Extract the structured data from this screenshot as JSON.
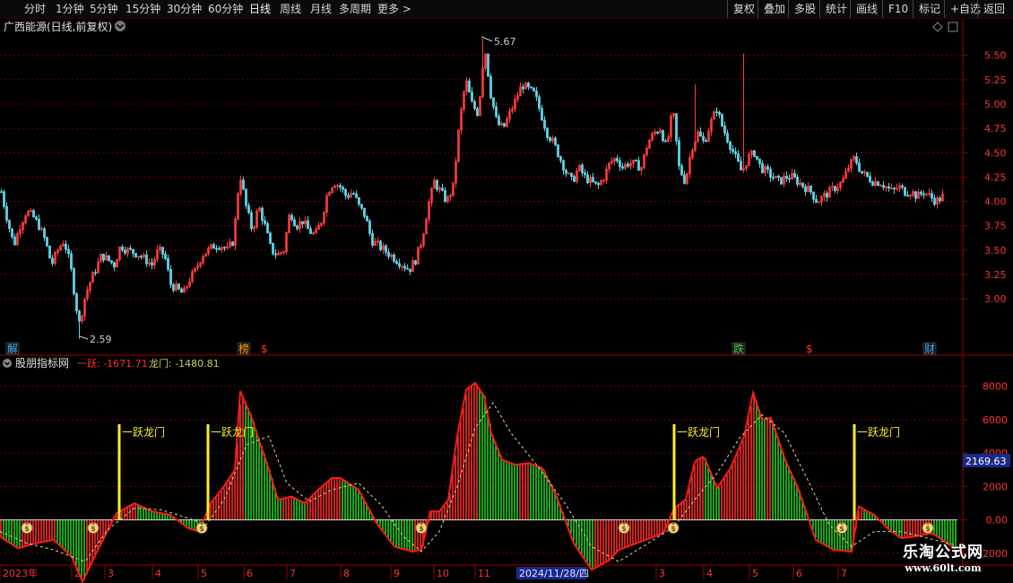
{
  "toolbar": {
    "left": [
      {
        "label": "分时",
        "name": "period-intraday"
      },
      {
        "label": "1分钟",
        "name": "period-1min"
      },
      {
        "label": "5分钟",
        "name": "period-5min"
      },
      {
        "label": "15分钟",
        "name": "period-15min"
      },
      {
        "label": "30分钟",
        "name": "period-30min"
      },
      {
        "label": "60分钟",
        "name": "period-60min"
      },
      {
        "label": "日线",
        "name": "period-daily",
        "active": true
      },
      {
        "label": "周线",
        "name": "period-weekly"
      },
      {
        "label": "月线",
        "name": "period-monthly"
      },
      {
        "label": "多周期",
        "name": "period-multi"
      },
      {
        "label": "更多 >",
        "name": "period-more"
      }
    ],
    "right": [
      {
        "label": "复权",
        "name": "restore-rights-button"
      },
      {
        "label": "叠加",
        "name": "overlay-button"
      },
      {
        "label": "多股",
        "name": "multi-stock-button"
      },
      {
        "label": "统计",
        "name": "statistics-button"
      },
      {
        "label": "画线",
        "name": "draw-line-button"
      },
      {
        "label": "F10",
        "name": "f10-button"
      },
      {
        "label": "标记",
        "name": "mark-button"
      },
      {
        "label": "+自选",
        "name": "add-watchlist-button"
      },
      {
        "label": "返回",
        "name": "back-button"
      }
    ]
  },
  "main_chart": {
    "title": "广西能源(日线,前复权)",
    "high_label": "5.67",
    "low_label": "2.59",
    "yaxis_ticks": [
      "5.50",
      "5.25",
      "5.00",
      "4.75",
      "4.50",
      "4.25",
      "4.00",
      "3.75",
      "3.50",
      "3.25",
      "3.00"
    ],
    "markers": [
      {
        "text": "解",
        "color": "#33aaff"
      },
      {
        "text": "榜",
        "color": "#ff9900"
      },
      {
        "text": "$",
        "color": "#ff3333"
      },
      {
        "text": "跌",
        "color": "#44cc44"
      },
      {
        "text": "$",
        "color": "#ff3333"
      },
      {
        "text": "财",
        "color": "#33aaff"
      }
    ]
  },
  "indicator": {
    "name": "股朋指标网",
    "line1_label": "一跃: -1671.71",
    "line2_label": "龙门: -1480.81",
    "yaxis_ticks": [
      "8000",
      "6000",
      "4000",
      "2000",
      "0.00",
      "-2000"
    ],
    "current_value": "2169.63",
    "signal_label": "一跃龙门",
    "colors": {
      "up": "#ff2a2a",
      "down": "#1fd01f",
      "signal": "#ffee22",
      "dashed": "#dddd99"
    }
  },
  "xaxis": {
    "labels": [
      "2023年",
      "2",
      "3",
      "4",
      "5",
      "6",
      "7",
      "8",
      "9",
      "10",
      "11",
      "3",
      "4",
      "5",
      "6",
      "7"
    ],
    "cursor_date": "2024/11/28/四"
  },
  "watermark": {
    "line1": "乐淘公式网",
    "line2": "www.60lt.com"
  },
  "chart_data": [
    {
      "type": "candlestick",
      "title": "广西能源(日线,前复权)",
      "ylim": [
        2.55,
        5.7
      ],
      "x": [
        0,
        7,
        14,
        21,
        28,
        35,
        42,
        49,
        56,
        63,
        70,
        77,
        84,
        88,
        91,
        98,
        105,
        112,
        119,
        126,
        133,
        140,
        147,
        154,
        161,
        168,
        175,
        182,
        189,
        196,
        203,
        210,
        217,
        224,
        231,
        238,
        245,
        252,
        259,
        266,
        273,
        280,
        287,
        294,
        301,
        308,
        315,
        322,
        329,
        336,
        343,
        350,
        357,
        364,
        371,
        378,
        385,
        392,
        399,
        406,
        413,
        420,
        427,
        434,
        441,
        448,
        455,
        462,
        469,
        476,
        483,
        490,
        497,
        504,
        511,
        518,
        525,
        532,
        539,
        546,
        553,
        560,
        567,
        574,
        581,
        588,
        595,
        602,
        609,
        616,
        623,
        630,
        637,
        644,
        651,
        658,
        665,
        672,
        679,
        686,
        693,
        700,
        707,
        714,
        721,
        728,
        735,
        742,
        749,
        756,
        763,
        770,
        777,
        784,
        791,
        798,
        805,
        812,
        819,
        826,
        833,
        840,
        847,
        854,
        861,
        868,
        875,
        882,
        889,
        896,
        903,
        910,
        917,
        924,
        931,
        938,
        945,
        952,
        959,
        966,
        973,
        980,
        987,
        994,
        1001,
        1008,
        1015,
        1022,
        1029,
        1036,
        1043,
        1050,
        1057,
        1064
      ],
      "close": [
        4.1,
        3.8,
        3.55,
        3.75,
        3.9,
        3.85,
        3.75,
        3.6,
        3.35,
        3.5,
        3.6,
        3.35,
        2.9,
        2.7,
        2.95,
        3.15,
        3.3,
        3.45,
        3.4,
        3.35,
        3.55,
        3.5,
        3.48,
        3.45,
        3.4,
        3.35,
        3.5,
        3.45,
        3.15,
        3.1,
        3.05,
        3.2,
        3.3,
        3.45,
        3.5,
        3.55,
        3.55,
        3.5,
        3.6,
        4.3,
        3.95,
        3.7,
        3.95,
        3.75,
        3.5,
        3.45,
        3.5,
        3.9,
        3.75,
        3.8,
        3.7,
        3.65,
        3.8,
        4.1,
        4.2,
        4.15,
        4.05,
        4.1,
        3.95,
        3.85,
        3.6,
        3.55,
        3.5,
        3.45,
        3.4,
        3.35,
        3.3,
        3.4,
        3.6,
        3.95,
        4.2,
        4.1,
        4.0,
        4.15,
        4.8,
        5.25,
        5.0,
        4.9,
        5.6,
        5.1,
        4.8,
        4.75,
        4.9,
        5.05,
        5.2,
        5.15,
        5.1,
        4.9,
        4.7,
        4.6,
        4.45,
        4.3,
        4.2,
        4.35,
        4.25,
        4.2,
        4.15,
        4.25,
        4.4,
        4.45,
        4.35,
        4.4,
        4.38,
        4.35,
        4.6,
        4.7,
        4.75,
        4.55,
        4.95,
        4.35,
        4.2,
        4.55,
        4.7,
        4.6,
        4.8,
        4.95,
        4.75,
        4.6,
        4.45,
        4.3,
        4.45,
        4.5,
        4.35,
        4.3,
        4.25,
        4.2,
        4.25,
        4.25,
        4.2,
        4.15,
        4.1,
        4.0,
        4.05,
        4.1,
        4.15,
        4.2,
        4.35,
        4.45,
        4.3,
        4.25,
        4.2,
        4.2,
        4.15,
        4.1,
        4.15,
        4.1,
        4.1,
        4.05,
        4.1,
        4.05,
        4.0,
        4.05
      ]
    },
    {
      "type": "bar",
      "title": "股朋指标网",
      "ylim": [
        -2600,
        9000
      ],
      "series": [
        {
          "name": "一跃",
          "x": [
            0,
            20,
            40,
            60,
            80,
            92,
            110,
            130,
            150,
            170,
            190,
            210,
            222,
            235,
            250,
            262,
            268,
            280,
            300,
            310,
            325,
            340,
            355,
            370,
            380,
            400,
            420,
            440,
            460,
            470,
            480,
            490,
            500,
            510,
            520,
            530,
            540,
            548,
            560,
            575,
            590,
            605,
            620,
            640,
            660,
            680,
            690,
            700,
            720,
            740,
            752,
            765,
            775,
            785,
            800,
            815,
            830,
            840,
            850,
            860,
            875,
            890,
            910,
            930,
            950,
            958,
            975,
            990,
            1005,
            1020,
            1040,
            1064
          ],
          "y": [
            -1000,
            -1700,
            -1400,
            -1200,
            -2200,
            -3700,
            -1700,
            400,
            1000,
            500,
            300,
            -500,
            -700,
            1000,
            2000,
            3000,
            7700,
            6200,
            3000,
            1200,
            1400,
            1000,
            1800,
            2500,
            2500,
            1800,
            -200,
            -1600,
            -1900,
            -1800,
            500,
            500,
            1200,
            5000,
            7800,
            8200,
            7400,
            5200,
            3600,
            3300,
            3400,
            3100,
            1500,
            -1400,
            -3000,
            -2400,
            -1800,
            -1600,
            -1200,
            -800,
            700,
            1200,
            3500,
            3800,
            1900,
            3100,
            5000,
            7600,
            6000,
            6100,
            3700,
            1900,
            -1200,
            -1800,
            -1900,
            800,
            300,
            -500,
            -1100,
            -1000,
            -800,
            -1671.71
          ]
        },
        {
          "name": "龙门",
          "x": [
            0,
            30,
            60,
            95,
            120,
            150,
            180,
            210,
            230,
            250,
            275,
            300,
            320,
            345,
            370,
            400,
            425,
            450,
            470,
            490,
            510,
            530,
            550,
            570,
            600,
            630,
            660,
            690,
            720,
            752,
            775,
            800,
            825,
            850,
            875,
            900,
            925,
            950,
            975,
            1005,
            1035,
            1064
          ],
          "y": [
            -700,
            -1400,
            -1800,
            -2500,
            -600,
            700,
            600,
            100,
            -300,
            1200,
            4500,
            5000,
            2200,
            1100,
            1800,
            2200,
            900,
            -1000,
            -1900,
            -700,
            2000,
            5500,
            7000,
            5200,
            3200,
            1000,
            -1600,
            -2500,
            -1500,
            -400,
            1200,
            2800,
            4900,
            6300,
            5200,
            2500,
            -300,
            -1600,
            -700,
            -700,
            -1100,
            -1480.81
          ]
        }
      ]
    }
  ]
}
